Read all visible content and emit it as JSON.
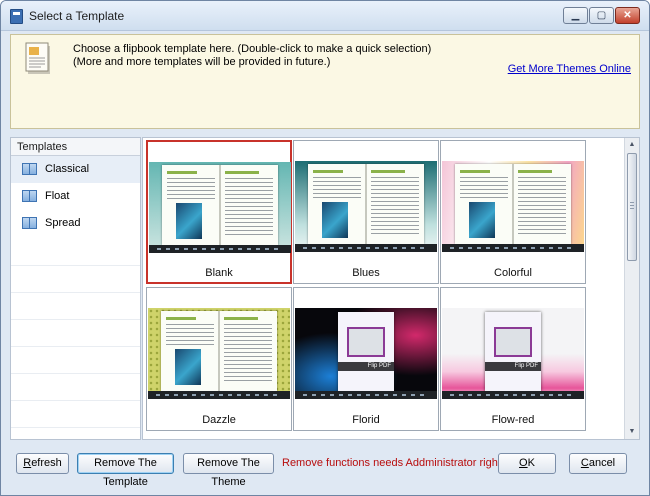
{
  "window": {
    "title": "Select a Template",
    "controls": {
      "minimize": "▁",
      "maximize": "▢",
      "close": "✕"
    }
  },
  "banner": {
    "line1": "Choose a flipbook template here. (Double-click to make a quick selection)",
    "line2": "(More and more templates will be provided in future.)",
    "link": "Get More Themes Online",
    "icon": "document-icon"
  },
  "sidebar": {
    "header": "Templates",
    "items": [
      {
        "label": "Classical",
        "icon": "template-icon"
      },
      {
        "label": "Float",
        "icon": "template-icon"
      },
      {
        "label": "Spread",
        "icon": "template-icon"
      }
    ]
  },
  "templates": [
    {
      "name": "Blank",
      "selected": true
    },
    {
      "name": "Blues",
      "selected": false
    },
    {
      "name": "Colorful",
      "selected": false
    },
    {
      "name": "Dazzle",
      "selected": false
    },
    {
      "name": "Florid",
      "selected": false
    },
    {
      "name": "Flow-red",
      "selected": false
    }
  ],
  "buttons": {
    "refresh": {
      "pre": "",
      "mnemonic": "R",
      "post": "efresh"
    },
    "remove_template": "Remove The Template",
    "remove_theme": "Remove The Theme",
    "ok": {
      "pre": "",
      "mnemonic": "O",
      "post": "K"
    },
    "cancel": {
      "pre": "",
      "mnemonic": "C",
      "post": "ancel"
    }
  },
  "warning": "Remove functions needs Addministrator rights!",
  "colors": {
    "selection_border": "#c8332b",
    "warning_text": "#b80d0d",
    "link": "#0000cc",
    "banner_bg": "#fbf8e4"
  }
}
